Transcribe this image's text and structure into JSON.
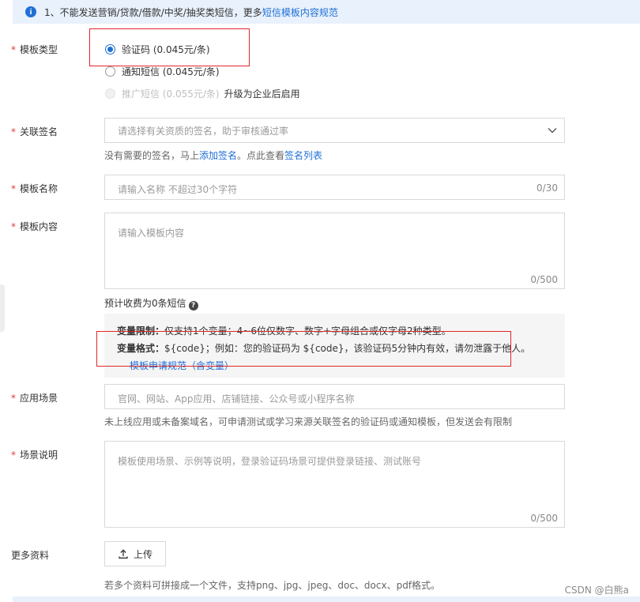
{
  "notice": {
    "text": "1、不能发送营销/贷款/借款/中奖/抽奖类短信，更多",
    "link": "短信模板内容规范"
  },
  "template_type": {
    "label": "模板类型",
    "options": [
      {
        "label": "验证码 (0.045元/条)",
        "state": "selected"
      },
      {
        "label": "通知短信 (0.045元/条)",
        "state": "unselected"
      },
      {
        "label": "推广短信 (0.055元/条)",
        "state": "disabled"
      }
    ],
    "upgrade_note": "升级为企业后启用"
  },
  "signature": {
    "label": "关联签名",
    "placeholder": "请选择有关资质的签名，助于审核通过率",
    "hint_prefix": "没有需要的签名，马上",
    "hint_link1": "添加签名",
    "hint_middle": "。点此查看",
    "hint_link2": "签名列表"
  },
  "template_name": {
    "label": "模板名称",
    "placeholder": "请输入名称 不超过30个字符",
    "counter": "0/30"
  },
  "template_content": {
    "label": "模板内容",
    "placeholder": "请输入模板内容",
    "counter": "0/500",
    "fee_text": "预计收费为0条短信",
    "restriction_label": "变量限制：",
    "restriction_text": "仅支持1个变量；4~6位仅数字、数字+字母组合或仅字母2种类型。",
    "format_label": "变量格式：",
    "format_text": "${code}；例如：您的验证码为 ${code}，该验证码5分钟内有效，请勿泄露于他人。",
    "spec_link": "模板申请规范（含变量）"
  },
  "scene": {
    "label": "应用场景",
    "placeholder": "官网、网站、App应用、店铺链接、公众号或小程序名称",
    "hint": "未上线应用或未备案域名，可申请测试或学习来源关联签名的验证码或通知模板，但发送会有限制"
  },
  "scene_desc": {
    "label": "场景说明",
    "placeholder": "模板使用场景、示例等说明，登录验证码场景可提供登录链接、测试账号",
    "counter": "0/500"
  },
  "more_info": {
    "label": "更多资料",
    "upload_label": "上传",
    "hint": "若多个资料可拼接成一个文件，支持png、jpg、jpeg、doc、docx、pdf格式。"
  },
  "watermark": "CSDN @白熊a",
  "colors": {
    "accent": "#1f6fd6",
    "required": "#e4393c",
    "highlight_box": "#e0272c"
  }
}
